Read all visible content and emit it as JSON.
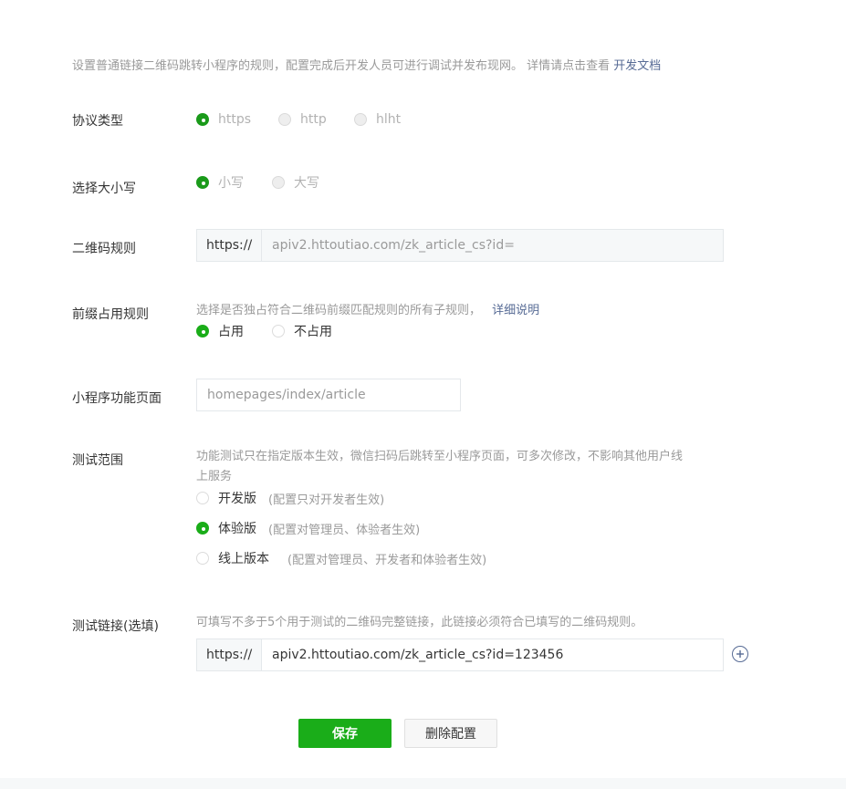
{
  "intro": {
    "text": "设置普通链接二维码跳转小程序的规则，配置完成后开发人员可进行调试并发布现网。 详情请点击查看",
    "link": "开发文档"
  },
  "protocol": {
    "label": "协议类型",
    "options": [
      "https",
      "http",
      "hlht"
    ],
    "selected": "https"
  },
  "case": {
    "label": "选择大小写",
    "options": [
      "小写",
      "大写"
    ],
    "selected": "小写"
  },
  "qr_rule": {
    "label": "二维码规则",
    "prefix": "https://",
    "value": "apiv2.httoutiao.com/zk_article_cs?id="
  },
  "prefix_rule": {
    "label": "前缀占用规则",
    "hint": "选择是否独占符合二维码前缀匹配规则的所有子规则，",
    "hint_link": "详细说明",
    "options": [
      "占用",
      "不占用"
    ],
    "selected": "占用"
  },
  "page": {
    "label": "小程序功能页面",
    "placeholder": "homepages/index/article"
  },
  "test_scope": {
    "label": "测试范围",
    "hint_line1": "功能测试只在指定版本生效，微信扫码后跳转至小程序页面，可多次修改，不影响其他用户线",
    "hint_line2": "上服务",
    "options": [
      {
        "label": "开发版",
        "note": "(配置只对开发者生效)"
      },
      {
        "label": "体验版",
        "note": "(配置对管理员、体验者生效)"
      },
      {
        "label": "线上版本",
        "note": "(配置对管理员、开发者和体验者生效)"
      }
    ],
    "selected": "体验版"
  },
  "test_link": {
    "label": "测试链接(选填)",
    "hint": "可填写不多于5个用于测试的二维码完整链接，此链接必须符合已填写的二维码规则。",
    "prefix": "https://",
    "value": "apiv2.httoutiao.com/zk_article_cs?id=123456",
    "add_icon": "plus-circle-icon"
  },
  "actions": {
    "save": "保存",
    "delete": "删除配置"
  },
  "colors": {
    "accent": "#1aad19",
    "link": "#576b95"
  }
}
